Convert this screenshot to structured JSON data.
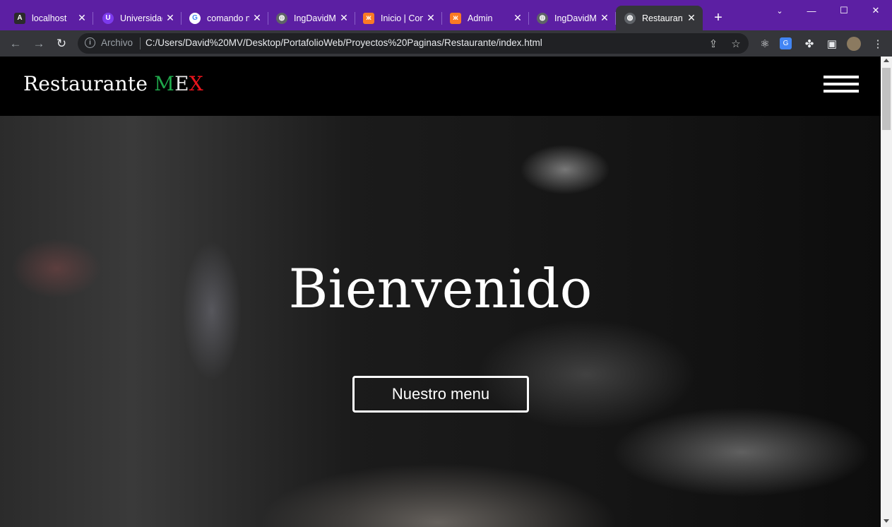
{
  "browser": {
    "tabs": [
      {
        "title": "localhost",
        "icon": "angular-icon",
        "icon_glyph": "A",
        "icon_bg": "#2b2b2b"
      },
      {
        "title": "Universidad",
        "icon": "university-icon",
        "icon_glyph": "U",
        "icon_bg": "#7c3aed"
      },
      {
        "title": "comando n",
        "icon": "google-icon",
        "icon_glyph": "G",
        "icon_bg": "#ffffff"
      },
      {
        "title": "IngDavidM",
        "icon": "globe-icon",
        "icon_glyph": "◍",
        "icon_bg": "#5f6368"
      },
      {
        "title": "Inicio | Con",
        "icon": "xampp-icon",
        "icon_glyph": "ж",
        "icon_bg": "#fb7a24"
      },
      {
        "title": "Admin",
        "icon": "xampp-icon",
        "icon_glyph": "ж",
        "icon_bg": "#fb7a24"
      },
      {
        "title": "IngDavidM",
        "icon": "globe-icon",
        "icon_glyph": "◍",
        "icon_bg": "#5f6368"
      },
      {
        "title": "Restaurante",
        "icon": "globe-icon",
        "icon_glyph": "◍",
        "icon_bg": "#5f6368",
        "active": true
      }
    ],
    "new_tab": "+",
    "omnibox": {
      "label": "Archivo",
      "url": "C:/Users/David%20MV/Desktop/PortafolioWeb/Proyectos%20Paginas/Restaurante/index.html"
    }
  },
  "site": {
    "brand": {
      "name": "Restaurante",
      "m": "M",
      "e": "E",
      "x": "X"
    },
    "hero": {
      "title": "Bienvenido",
      "button": "Nuestro menu"
    }
  },
  "colors": {
    "tabstrip": "#5c1fa3",
    "toolbar": "#35363a",
    "brand_green": "#1fa64a",
    "brand_red": "#e8141c"
  }
}
